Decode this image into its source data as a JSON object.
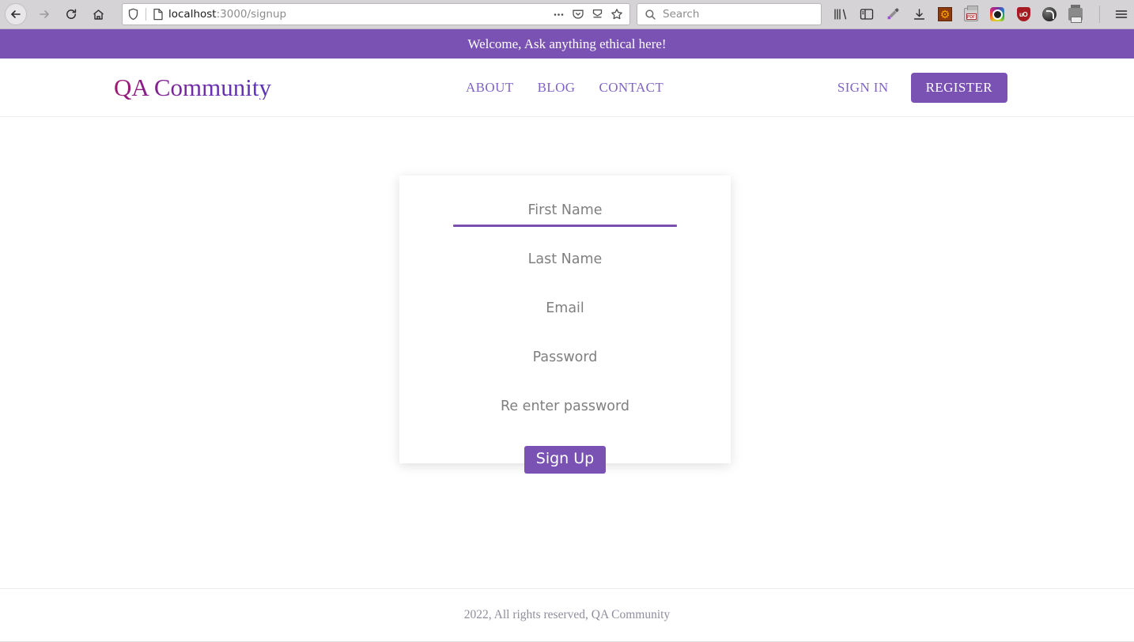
{
  "browser": {
    "nav": {
      "back_label": "Back",
      "forward_label": "Forward",
      "reload_label": "Reload",
      "home_label": "Home"
    },
    "url": {
      "host": "localhost",
      "path": ":3000/signup",
      "full": "localhost:3000/signup",
      "shield_icon": "shield-icon",
      "page_icon": "page-icon",
      "more_icon": "ellipsis-icon",
      "pocket_icon": "pocket-icon",
      "save_icon": "save-to-icon",
      "bookmark_icon": "star-icon"
    },
    "search": {
      "placeholder": "Search",
      "icon": "magnifier-icon"
    },
    "toolbar_icons": [
      "library-icon",
      "sidebar-icon",
      "eyedropper-icon",
      "downloads-icon",
      "gear-extension-icon",
      "pdf-printer-icon",
      "screenshot-camera-icon",
      "ublock-shield-icon",
      "dark-reader-icon",
      "print-icon",
      "hamburger-menu-icon"
    ]
  },
  "banner": {
    "text": "Welcome, Ask anything ethical here!",
    "background": "#7952b3",
    "text_color": "#ffffff"
  },
  "header": {
    "brand": "QA Community",
    "nav": [
      {
        "label": "ABOUT"
      },
      {
        "label": "BLOG"
      },
      {
        "label": "CONTACT"
      }
    ],
    "sign_in_label": "SIGN IN",
    "register_label": "REGISTER",
    "link_color": "#7f63c6",
    "accent_color": "#7952b3"
  },
  "signup_form": {
    "fields": [
      {
        "name": "first-name",
        "placeholder": "First Name",
        "value": "",
        "type": "text",
        "focused": true
      },
      {
        "name": "last-name",
        "placeholder": "Last Name",
        "value": "",
        "type": "text",
        "focused": false
      },
      {
        "name": "email",
        "placeholder": "Email",
        "value": "",
        "type": "email",
        "focused": false
      },
      {
        "name": "password",
        "placeholder": "Password",
        "value": "",
        "type": "password",
        "focused": false
      },
      {
        "name": "confirm-password",
        "placeholder": "Re enter password",
        "value": "",
        "type": "password",
        "focused": false
      }
    ],
    "submit_label": "Sign Up",
    "focus_underline_color": "#7a4fb0"
  },
  "footer": {
    "text": "2022, All rights reserved, QA Community"
  }
}
